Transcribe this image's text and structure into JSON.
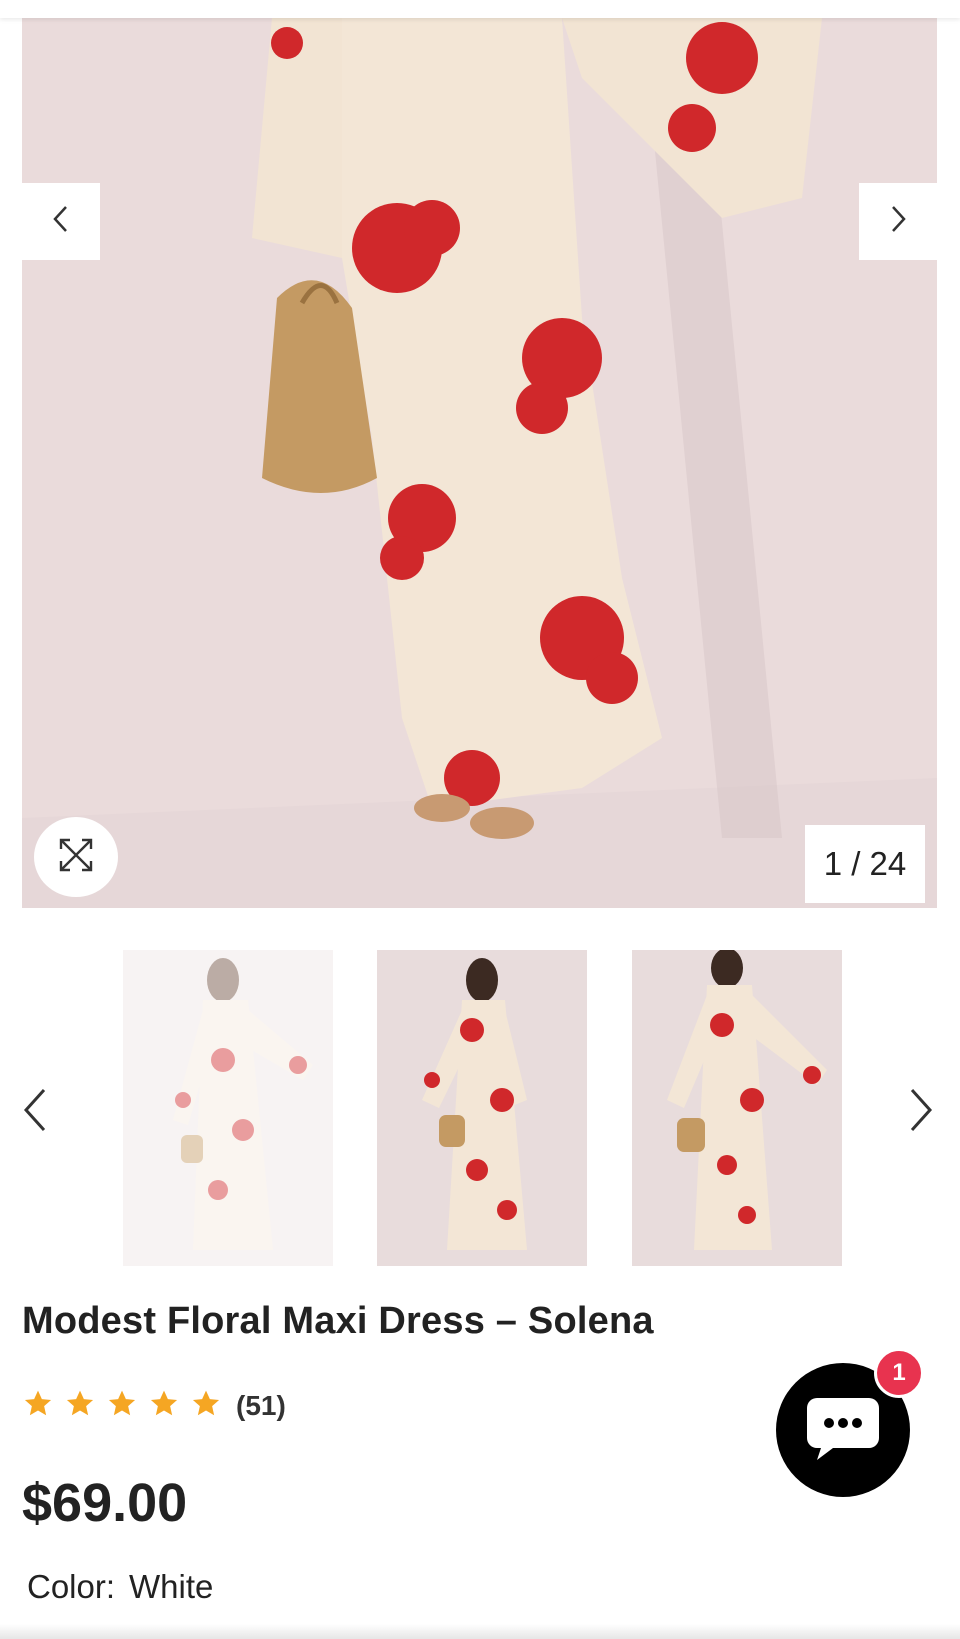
{
  "gallery": {
    "counter": "1 / 24",
    "prev_icon": "chevron-left-icon",
    "next_icon": "chevron-right-icon",
    "zoom_icon": "expand-icon"
  },
  "thumbnails": {
    "prev_icon": "chevron-left-icon",
    "next_icon": "chevron-right-icon",
    "items": [
      "thumb-1",
      "thumb-2",
      "thumb-3"
    ]
  },
  "product": {
    "title": "Modest Floral Maxi Dress – Solena",
    "rating_stars": 5,
    "rating_count": "(51)",
    "price": "$69.00",
    "color_label": "Color:",
    "color_value": "White"
  },
  "chat": {
    "badge": "1",
    "icon": "chat-bubble-icon"
  },
  "colors": {
    "star": "#f5a623",
    "badge": "#e8334f",
    "flower": "#d0282b",
    "dress": "#f3e6d6",
    "background": "#eadbdb"
  }
}
